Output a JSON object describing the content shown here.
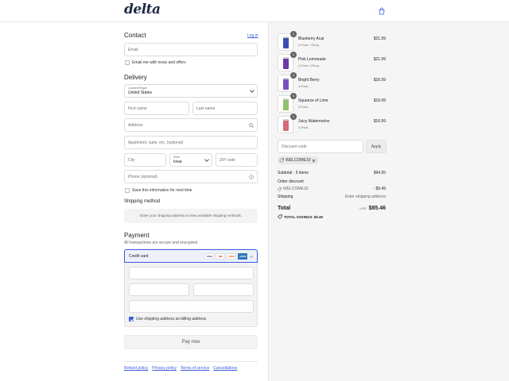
{
  "brand": {
    "logo": "delta"
  },
  "contact": {
    "title": "Contact",
    "login_link": "Log in",
    "email_placeholder": "Email",
    "newsletter_label": "Email me with news and offers"
  },
  "delivery": {
    "title": "Delivery",
    "country_label": "Country/Region",
    "country_value": "United States",
    "first_name": "First name",
    "last_name": "Last name",
    "address": "Address",
    "apartment": "Apartment, suite, etc. (optional)",
    "city": "City",
    "state_label": "State",
    "state_value": "Iowa",
    "zip": "ZIP code",
    "phone": "Phone (optional)",
    "save_label": "Save this information for next time"
  },
  "shipping_method": {
    "title": "Shipping method",
    "note": "Enter your shipping address to view available shipping methods."
  },
  "payment": {
    "title": "Payment",
    "subtitle": "All transactions are secure and encrypted.",
    "credit_card_label": "Credit card",
    "cards": [
      "VISA",
      "MC",
      "DISC",
      "AMEX"
    ],
    "more_cards": "+3",
    "billing_label": "Use shipping address as billing address",
    "pay_button": "Pay now"
  },
  "footer": {
    "links": [
      "Refund policy",
      "Privacy policy",
      "Terms of service",
      "Cancellations"
    ]
  },
  "cart": {
    "items": [
      {
        "name": "Blueberry Acai",
        "variant": "4-Pack / 20mg",
        "price": "$21.99",
        "qty": "1",
        "color": "#3a4fb0"
      },
      {
        "name": "Pink Lemonade",
        "variant": "4-Pack / 20mg",
        "price": "$21.99",
        "qty": "1",
        "color": "#6a3aa8"
      },
      {
        "name": "Bright Berry",
        "variant": "4-Pack",
        "price": "$16.99",
        "qty": "1",
        "color": "#7b4fc4"
      },
      {
        "name": "Squeeze of Lime",
        "variant": "4-Pack",
        "price": "$16.99",
        "qty": "1",
        "color": "#8fc26b"
      },
      {
        "name": "Juicy Watermelon",
        "variant": "4-Pack",
        "price": "$16.99",
        "qty": "1",
        "color": "#d46a7a"
      }
    ],
    "discount_placeholder": "Discount code",
    "apply_label": "Apply",
    "applied_code": "WELCOME10"
  },
  "summary": {
    "subtotal_label": "Subtotal · 5 items",
    "subtotal_value": "$94.95",
    "order_discount_label": "Order discount",
    "discount_code": "WELCOME10",
    "discount_value": "- $9.49",
    "shipping_label": "Shipping",
    "shipping_value": "Enter shipping address",
    "total_label": "Total",
    "currency": "USD",
    "total_value": "$85.46",
    "savings_label": "TOTAL SAVINGS",
    "savings_value": "$9.49"
  }
}
